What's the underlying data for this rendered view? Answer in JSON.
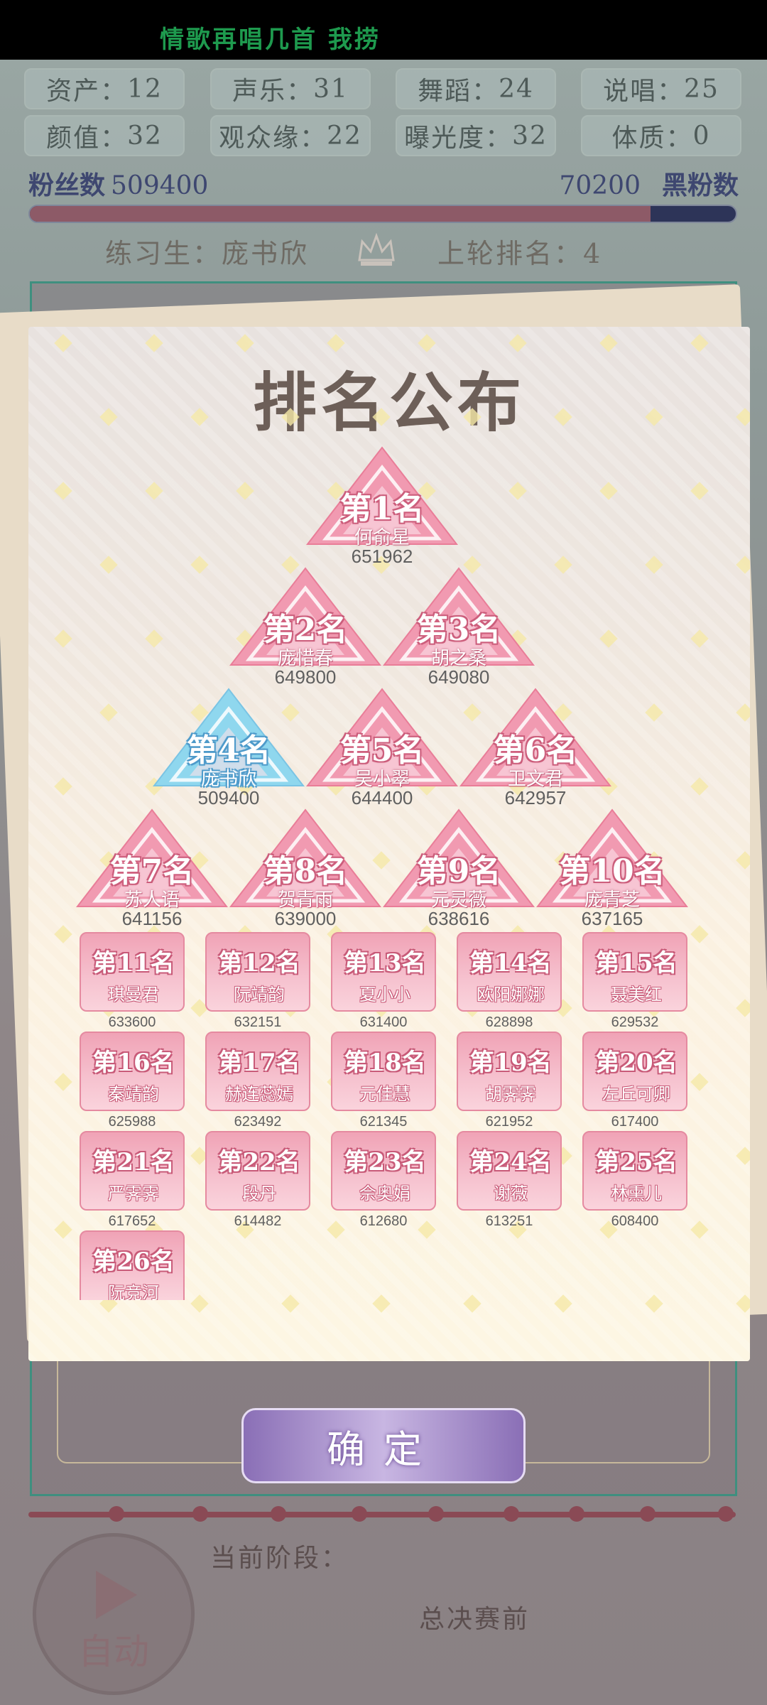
{
  "marquee": "情歌再唱几首 我捞",
  "stats": [
    {
      "label": "资产",
      "value": "12"
    },
    {
      "label": "声乐",
      "value": "31"
    },
    {
      "label": "舞蹈",
      "value": "24"
    },
    {
      "label": "说唱",
      "value": "25"
    },
    {
      "label": "颜值",
      "value": "32"
    },
    {
      "label": "观众缘",
      "value": "22"
    },
    {
      "label": "曝光度",
      "value": "32"
    },
    {
      "label": "体质",
      "value": "0"
    }
  ],
  "fans": {
    "label": "粉丝数",
    "value": "509400",
    "anti_value": "70200",
    "anti_label": "黑粉数",
    "ratio": 0.879
  },
  "trainee": "练习生：庞书欣",
  "last_rank": "上轮排名：4",
  "panel_title": "排名公布",
  "top_ranks": [
    {
      "rank": "第1名",
      "name": "何俞星",
      "score": "651962",
      "color": "#f19ab1"
    },
    {
      "rank": "第2名",
      "name": "庞惜春",
      "score": "649800",
      "color": "#f19ab1"
    },
    {
      "rank": "第3名",
      "name": "胡之桑",
      "score": "649080",
      "color": "#f19ab1"
    },
    {
      "rank": "第4名",
      "name": "庞书欣",
      "score": "509400",
      "color": "#8fd7ee"
    },
    {
      "rank": "第5名",
      "name": "吴小翠",
      "score": "644400",
      "color": "#f19ab1"
    },
    {
      "rank": "第6名",
      "name": "卫文君",
      "score": "642957",
      "color": "#f19ab1"
    },
    {
      "rank": "第7名",
      "name": "苏人语",
      "score": "641156",
      "color": "#f19ab1"
    },
    {
      "rank": "第8名",
      "name": "贺青雨",
      "score": "639000",
      "color": "#f19ab1"
    },
    {
      "rank": "第9名",
      "name": "元灵薇",
      "score": "638616",
      "color": "#f19ab1"
    },
    {
      "rank": "第10名",
      "name": "庞青芝",
      "score": "637165",
      "color": "#f19ab1"
    }
  ],
  "card_ranks": [
    {
      "rank": "第11名",
      "name": "琪曼君",
      "score": "633600"
    },
    {
      "rank": "第12名",
      "name": "阮靖韵",
      "score": "632151"
    },
    {
      "rank": "第13名",
      "name": "夏小小",
      "score": "631400"
    },
    {
      "rank": "第14名",
      "name": "欧阳娜娜",
      "score": "628898"
    },
    {
      "rank": "第15名",
      "name": "聂美红",
      "score": "629532"
    },
    {
      "rank": "第16名",
      "name": "秦靖韵",
      "score": "625988"
    },
    {
      "rank": "第17名",
      "name": "赫连蕊嫣",
      "score": "623492"
    },
    {
      "rank": "第18名",
      "name": "元佳慧",
      "score": "621345"
    },
    {
      "rank": "第19名",
      "name": "胡霁霁",
      "score": "621952"
    },
    {
      "rank": "第20名",
      "name": "左丘可卿",
      "score": "617400"
    },
    {
      "rank": "第21名",
      "name": "严霁霁",
      "score": "617652"
    },
    {
      "rank": "第22名",
      "name": "段丹",
      "score": "614482"
    },
    {
      "rank": "第23名",
      "name": "佘奥娟",
      "score": "612680"
    },
    {
      "rank": "第24名",
      "name": "谢薇",
      "score": "613251"
    },
    {
      "rank": "第25名",
      "name": "林熏儿",
      "score": "608400"
    },
    {
      "rank": "第26名",
      "name": "阮竞河",
      "score": ""
    }
  ],
  "confirm_label": "确定",
  "stage_label": "当前阶段：",
  "stage_value": "总决赛前",
  "auto_label": "自动"
}
